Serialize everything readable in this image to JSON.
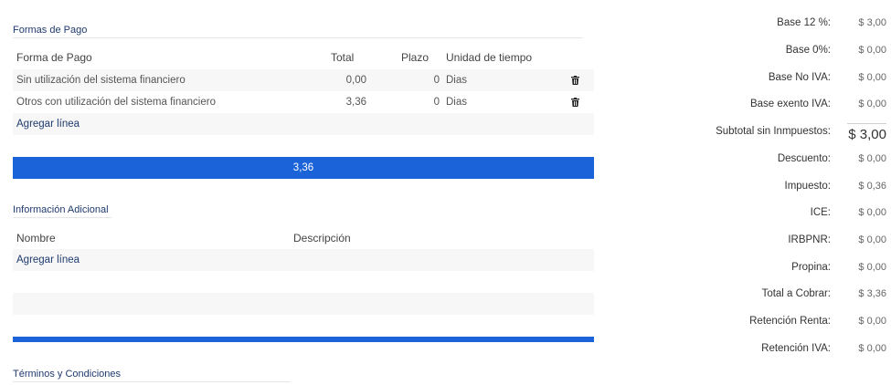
{
  "payment": {
    "title": "Formas de Pago",
    "headers": {
      "forma": "Forma de Pago",
      "total": "Total",
      "plazo": "Plazo",
      "unidad": "Unidad de tiempo"
    },
    "rows": [
      {
        "forma": "Sin utilización del sistema financiero",
        "total": "0,00",
        "plazo": "0",
        "unidad": "Dias"
      },
      {
        "forma": "Otros con utilización del sistema financiero",
        "total": "3,36",
        "plazo": "0",
        "unidad": "Dias"
      }
    ],
    "add_line": "Agregar línea",
    "sum": "3,36"
  },
  "info": {
    "title": "Información Adicional",
    "headers": {
      "nombre": "Nombre",
      "descripcion": "Descripción"
    },
    "add_line": "Agregar línea"
  },
  "terms": {
    "title": "Términos y Condiciones"
  },
  "totals": [
    {
      "label": "Base 12 %:",
      "value": "$ 3,00"
    },
    {
      "label": "Base 0%:",
      "value": "$ 0,00"
    },
    {
      "label": "Base No IVA:",
      "value": "$ 0,00"
    },
    {
      "label": "Base exento IVA:",
      "value": "$ 0,00"
    },
    {
      "label": "Subtotal sin Inmpuestos:",
      "value": "$ 3,00"
    },
    {
      "label": "Descuento:",
      "value": "$ 0,00"
    },
    {
      "label": "Impuesto:",
      "value": "$ 0,36"
    },
    {
      "label": "ICE:",
      "value": "$ 0,00"
    },
    {
      "label": "IRBPNR:",
      "value": "$ 0,00"
    },
    {
      "label": "Propina:",
      "value": "$ 0,00"
    },
    {
      "label": "Total a Cobrar:",
      "value": "$ 3,36"
    },
    {
      "label": "Retención Renta:",
      "value": "$ 0,00"
    },
    {
      "label": "Retención IVA:",
      "value": "$ 0,00"
    }
  ]
}
